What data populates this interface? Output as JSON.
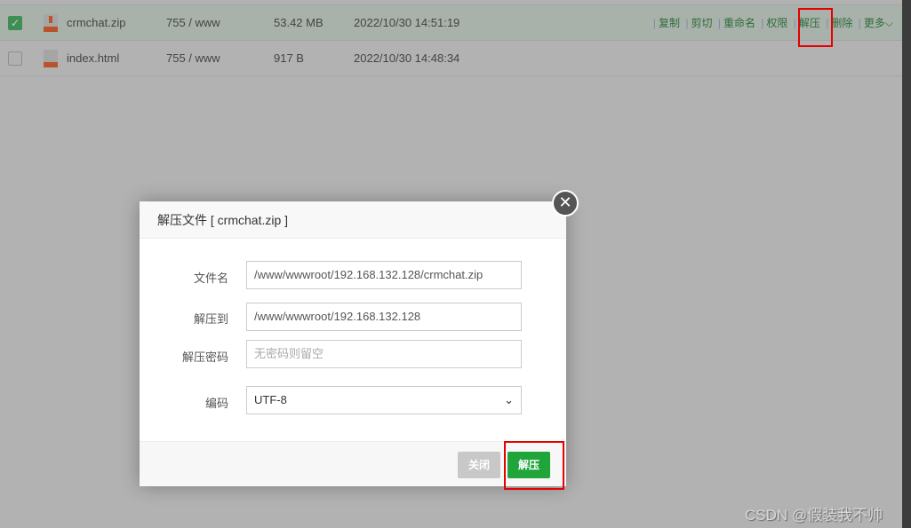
{
  "files": [
    {
      "name": "crmchat.zip",
      "perm": "755 / www",
      "size": "53.42 MB",
      "mtime": "2022/10/30 14:51:19",
      "checked": true,
      "icon": "zip-file-icon"
    },
    {
      "name": "index.html",
      "perm": "755 / www",
      "size": "917 B",
      "mtime": "2022/10/30 14:48:34",
      "checked": false,
      "icon": "html-file-icon"
    }
  ],
  "actions": [
    "复制",
    "剪切",
    "重命名",
    "权限",
    "解压",
    "删除",
    "更多"
  ],
  "dialog": {
    "title": "解压文件 [ crmchat.zip ]",
    "filename_label": "文件名",
    "filename_value": "/www/wwwroot/192.168.132.128/crmchat.zip",
    "dest_label": "解压到",
    "dest_value": "/www/wwwroot/192.168.132.128",
    "password_label": "解压密码",
    "password_placeholder": "无密码则留空",
    "encoding_label": "编码",
    "encoding_value": "UTF-8",
    "close_label": "关闭",
    "submit_label": "解压"
  },
  "colors": {
    "accent": "#20a53a",
    "highlight": "#e60000"
  },
  "watermark": "CSDN @假装我不帅"
}
